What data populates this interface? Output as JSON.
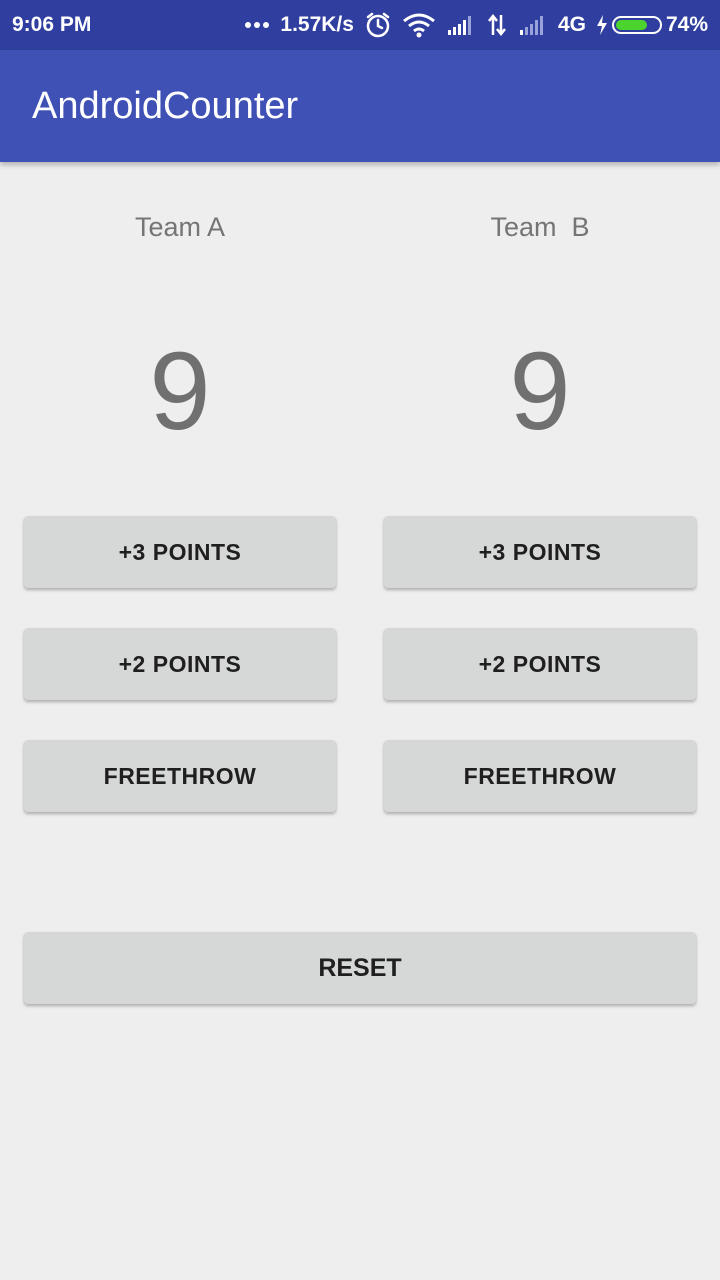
{
  "status_bar": {
    "time": "9:06 PM",
    "network_speed": "1.57K/s",
    "network_type": "4G",
    "battery_percent": "74%",
    "battery_level": 0.74,
    "icons": [
      "dots-icon",
      "alarm-icon",
      "wifi-icon",
      "signal-icon",
      "data-transfer-icon",
      "signal-icon",
      "charging-icon",
      "battery-icon"
    ]
  },
  "app_bar": {
    "title": "AndroidCounter",
    "color": "#3f51b5"
  },
  "team_a": {
    "name": "Team A",
    "score": "9",
    "buttons": {
      "plus3": "+3 POINTS",
      "plus2": "+2 POINTS",
      "freethrow": "FREETHROW"
    }
  },
  "team_b": {
    "name": "Team  B",
    "score": "9",
    "buttons": {
      "plus3": "+3 POINTS",
      "plus2": "+2 POINTS",
      "freethrow": "FREETHROW"
    }
  },
  "reset_label": "RESET"
}
